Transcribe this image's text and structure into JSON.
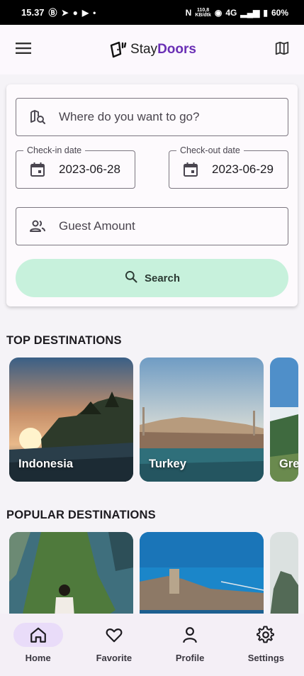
{
  "status_bar": {
    "time": "15.37",
    "net_speed_top": "110,8",
    "net_speed_bottom": "KB/dtk",
    "network": "4G",
    "battery": "60%"
  },
  "app_bar": {
    "menu_icon": "menu-icon",
    "logo_prefix": "Stay",
    "logo_suffix": "Doors",
    "map_icon": "map-icon",
    "brand_color": "#6a2fb5"
  },
  "search": {
    "destination_placeholder": "Where do you want to go?",
    "checkin_label": "Check-in date",
    "checkin_value": "2023-06-28",
    "checkout_label": "Check-out date",
    "checkout_value": "2023-06-29",
    "guest_placeholder": "Guest Amount",
    "button_label": "Search",
    "button_color": "#c7f1dc"
  },
  "top_destinations": {
    "title": "TOP DESTINATIONS",
    "items": [
      {
        "label": "Indonesia"
      },
      {
        "label": "Turkey"
      },
      {
        "label": "Gre"
      }
    ]
  },
  "popular_destinations": {
    "title": "POPULAR DESTINATIONS"
  },
  "bottom_nav": {
    "items": [
      {
        "label": "Home",
        "icon": "home-icon",
        "active": true
      },
      {
        "label": "Favorite",
        "icon": "heart-icon"
      },
      {
        "label": "Profile",
        "icon": "person-icon"
      },
      {
        "label": "Settings",
        "icon": "gear-icon"
      }
    ]
  }
}
